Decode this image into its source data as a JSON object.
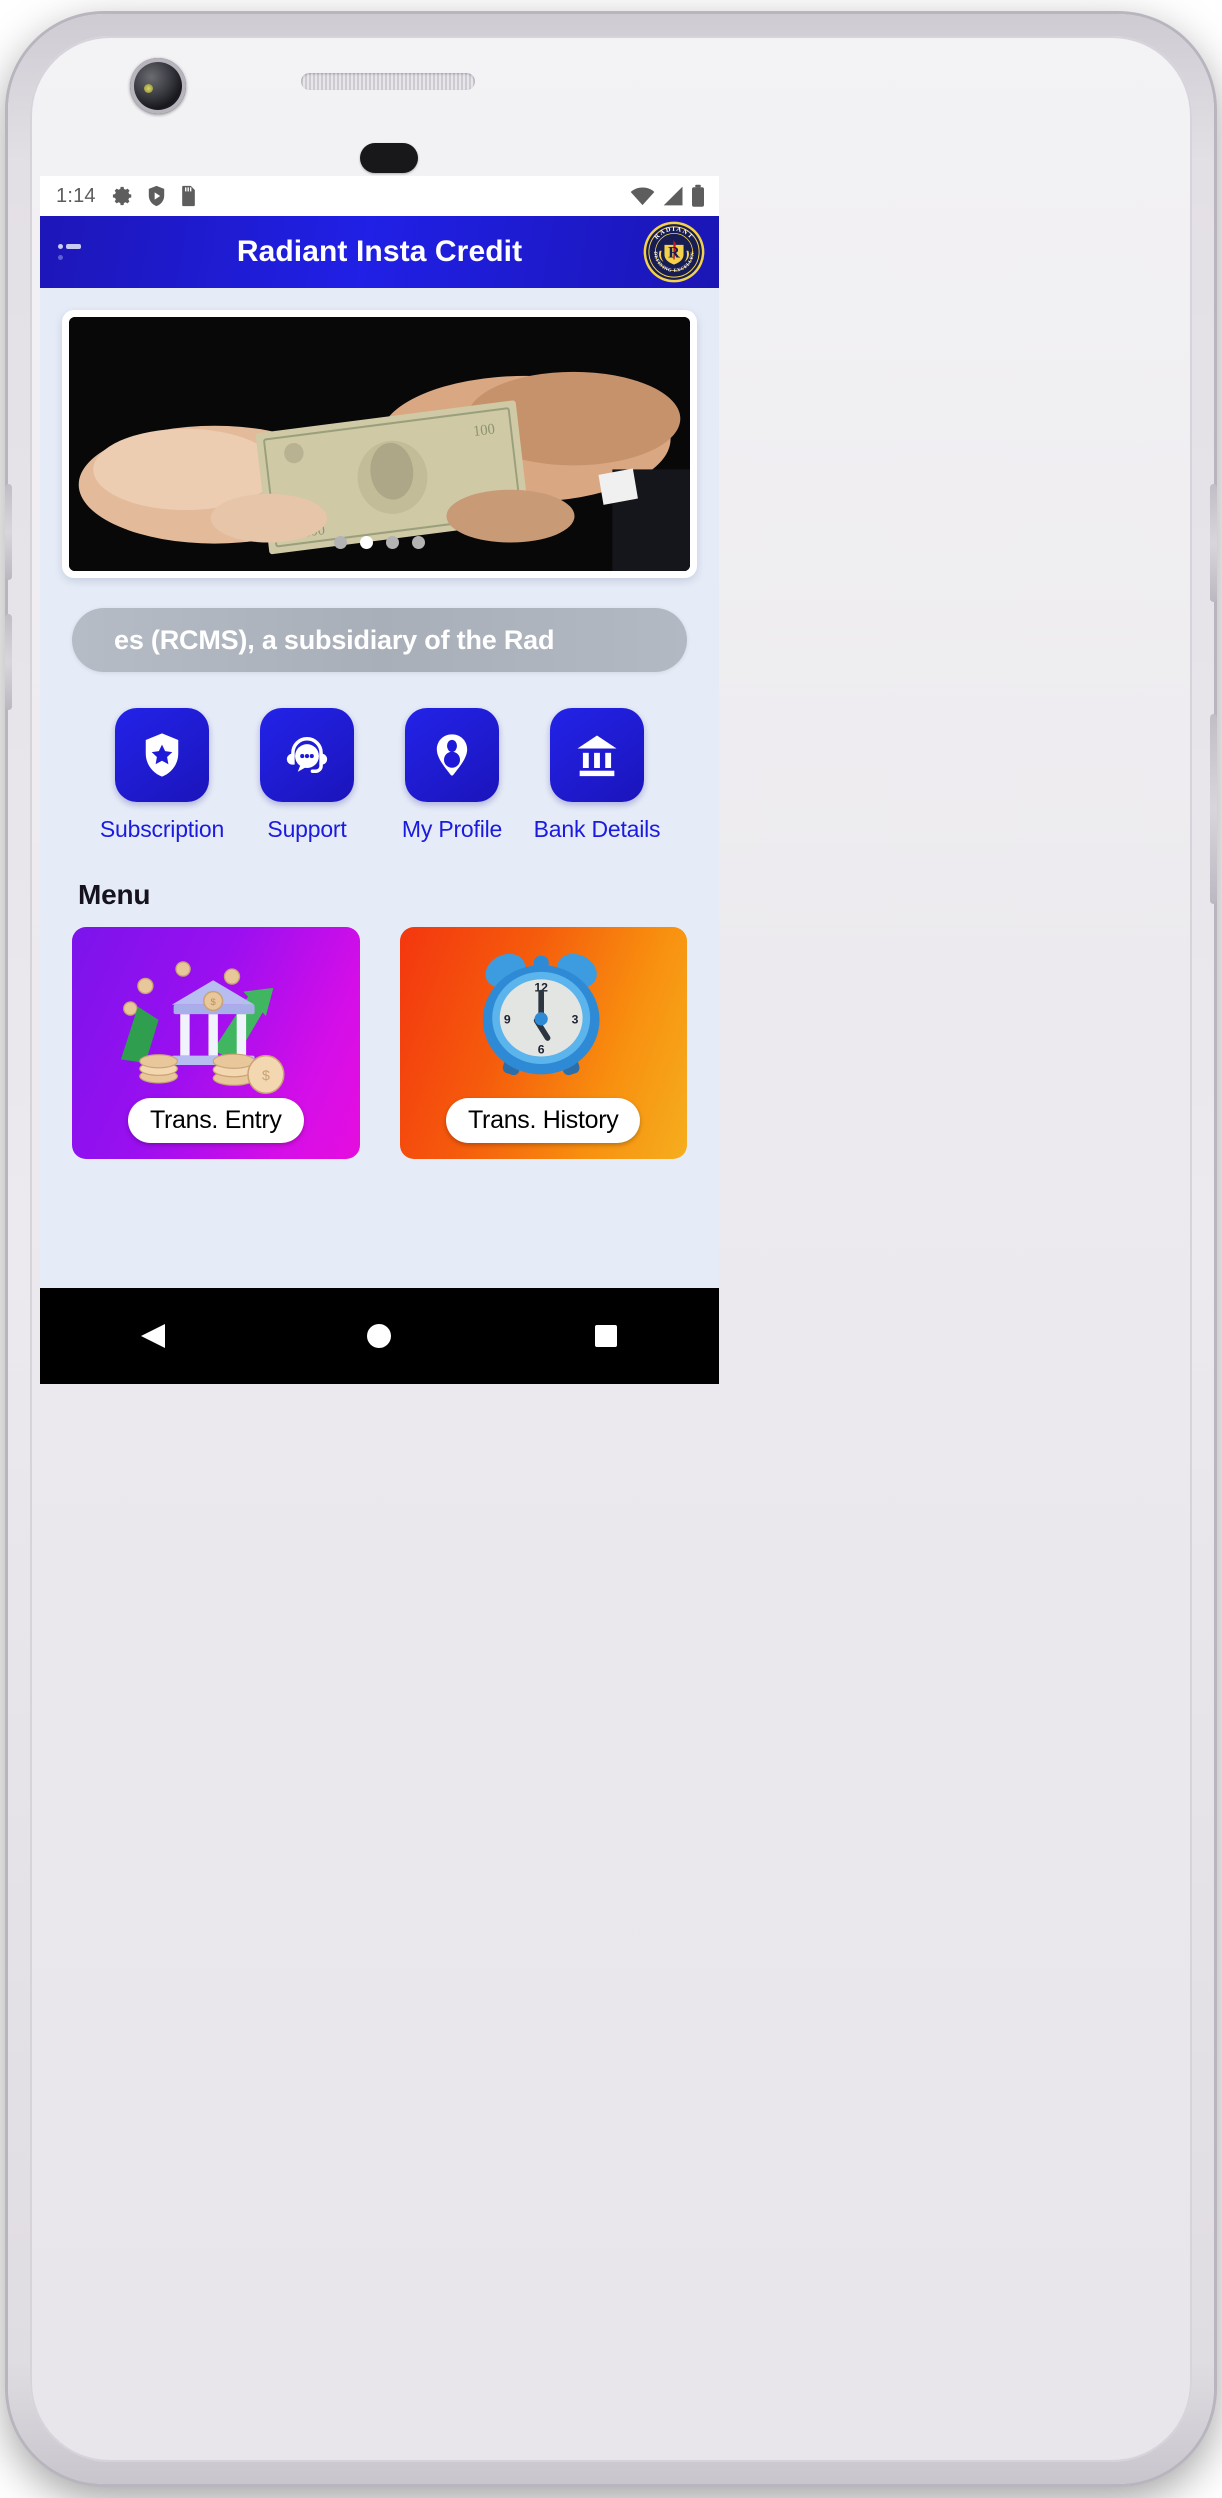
{
  "device": {
    "camera_icon": "front-camera",
    "earpiece_icon": "earpiece-speaker",
    "punch_hole_icon": "sensor-pill"
  },
  "status_bar": {
    "time": "1:14",
    "left_icons": [
      "gear-icon",
      "shield-play-icon",
      "sd-card-icon"
    ],
    "right_icons": [
      "wifi-icon",
      "cellular-signal-icon",
      "battery-icon"
    ]
  },
  "app_bar": {
    "title": "Radiant Insta Credit",
    "menu_icon": "list-menu-icon",
    "logo_icon": "radiant-brand-logo",
    "logo_top_text": "RADIANT",
    "logo_bottom_text": "REDEFINING EXCELLENCE",
    "logo_monogram": "R",
    "background_color": "#2020E6"
  },
  "carousel": {
    "image_alt": "hand-exchanging-dollar-bill-photo",
    "slide_count": 4,
    "active_index": 1
  },
  "marquee": {
    "text": "es (RCMS), a subsidiary of the Rad"
  },
  "quick_actions": [
    {
      "label": "Subscription",
      "icon": "shield-star-icon"
    },
    {
      "label": "Support",
      "icon": "headset-chat-icon"
    },
    {
      "label": "My Profile",
      "icon": "person-pin-icon"
    },
    {
      "label": "Bank Details",
      "icon": "bank-building-icon"
    }
  ],
  "menu": {
    "heading": "Menu",
    "cards": [
      {
        "label": "Trans. Entry",
        "icon": "bank-coins-growth-illustration",
        "gradient_from": "#7B14EC",
        "gradient_to": "#E60DDF"
      },
      {
        "label": "Trans. History",
        "icon": "alarm-clock-illustration",
        "gradient_from": "#F4360F",
        "gradient_to": "#F5AE1E"
      }
    ]
  },
  "nav_bar": {
    "back_icon": "back-triangle-icon",
    "home_icon": "home-circle-icon",
    "recents_icon": "recents-square-icon"
  }
}
